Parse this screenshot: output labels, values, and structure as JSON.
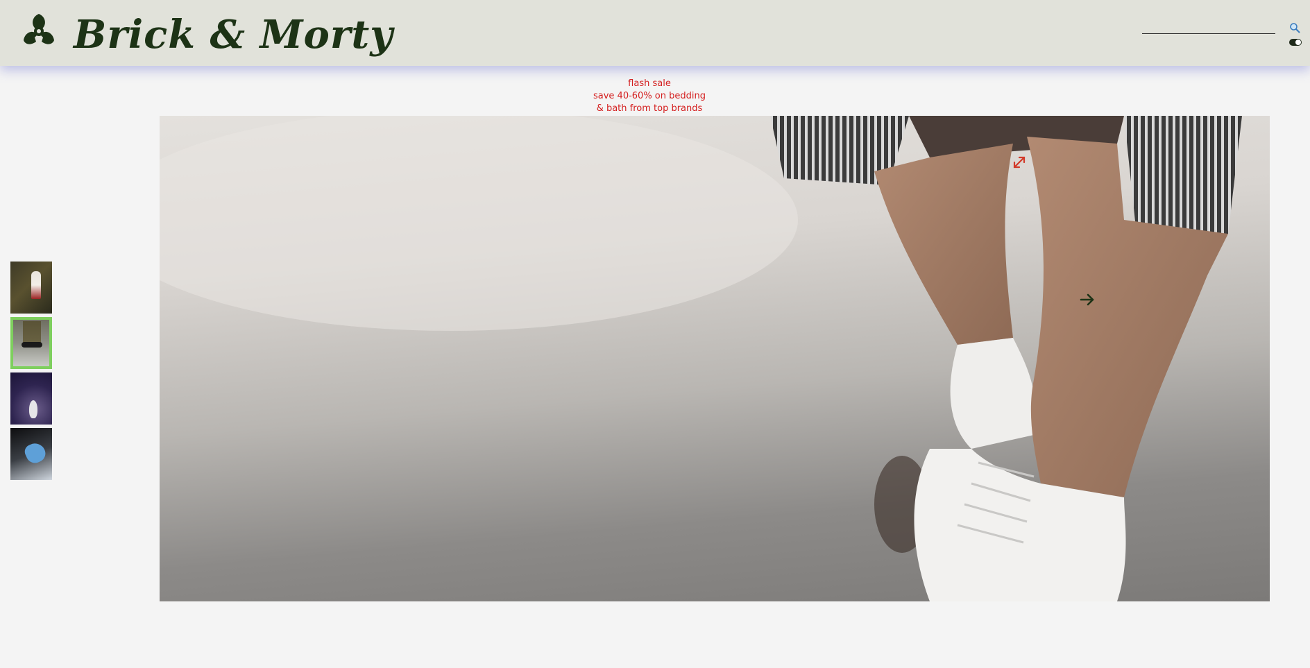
{
  "header": {
    "brand": "Brick & Morty",
    "logo_icon": "biohazard-icon",
    "search": {
      "placeholder": "",
      "value": "",
      "icon": "search-icon"
    },
    "theme_toggle": {
      "icon": "toggle-icon",
      "state": "on"
    }
  },
  "promo": {
    "line1": "flash sale",
    "line2": "save 40-60% on bedding",
    "line3": "& bath from top brands"
  },
  "gallery": {
    "thumbnails": [
      {
        "alt": "thumbnail-1",
        "active": false
      },
      {
        "alt": "thumbnail-2",
        "active": true
      },
      {
        "alt": "thumbnail-3",
        "active": false
      },
      {
        "alt": "thumbnail-4",
        "active": false
      }
    ],
    "main_image_icons": [
      "expand-icon",
      "arrow-right-icon"
    ]
  },
  "colors": {
    "header_bg": "#e1e2da",
    "brand_text": "#1d3316",
    "promo_text": "#d41e1e",
    "page_bg": "#f4f4f4",
    "active_thumb_border": "#7ecf5e",
    "expand_icon": "#d23a2a"
  }
}
